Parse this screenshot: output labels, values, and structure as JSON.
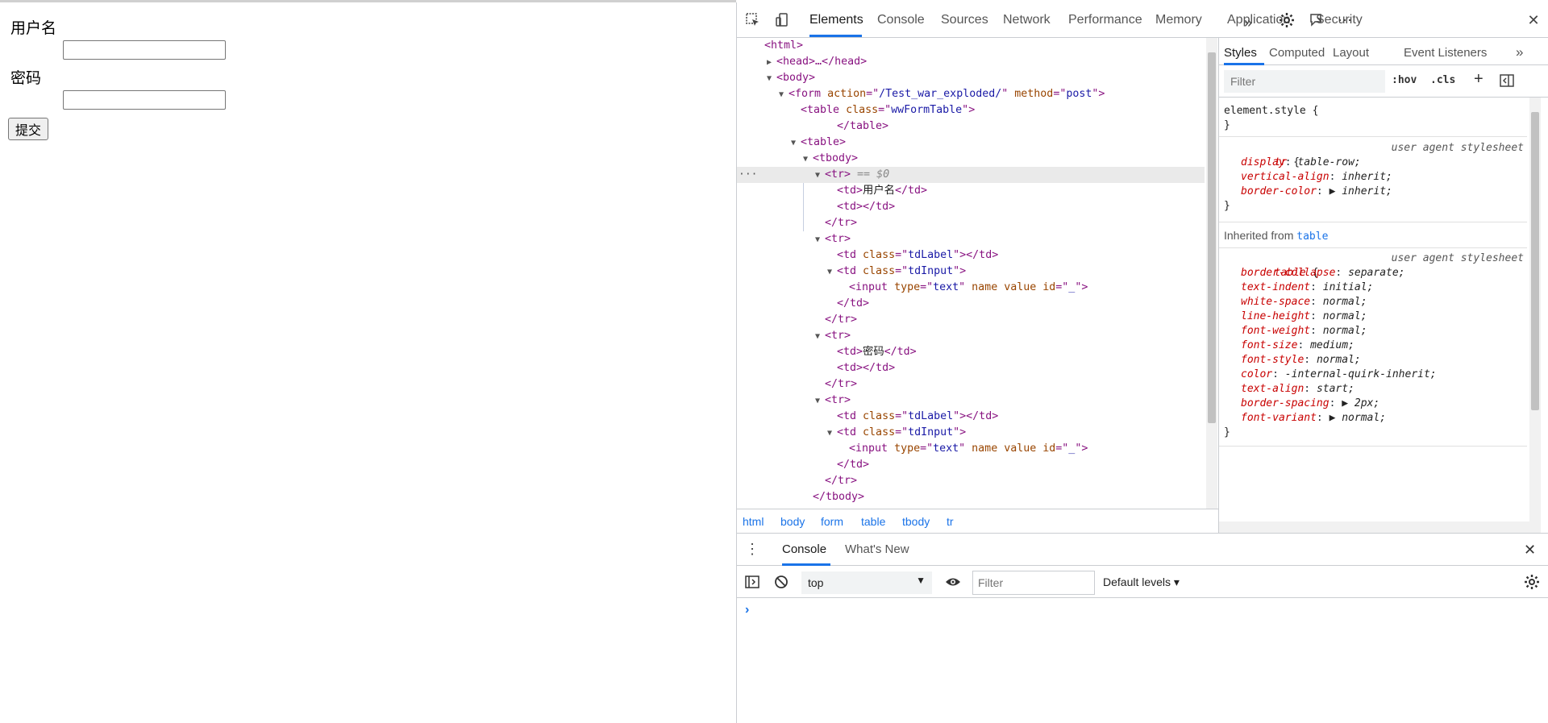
{
  "page": {
    "username_label": "用户名",
    "password_label": "密码",
    "submit_label": "提交",
    "username_value": "",
    "password_value": ""
  },
  "devtools": {
    "tabs": [
      "Elements",
      "Console",
      "Sources",
      "Network",
      "Performance",
      "Memory",
      "Application",
      "Security"
    ],
    "active_tab": "Elements",
    "more_tabs": "»",
    "dom": [
      {
        "indent": 0,
        "tri": "",
        "open": "<",
        "tag": "html",
        "attrs": [],
        "close": ">",
        "text": ""
      },
      {
        "indent": 1,
        "tri": "▶",
        "open": "<",
        "tag": "head",
        "attrs": [],
        "close": ">…</head>",
        "text": ""
      },
      {
        "indent": 1,
        "tri": "▼",
        "open": "<",
        "tag": "body",
        "attrs": [],
        "close": ">",
        "text": ""
      },
      {
        "indent": 2,
        "tri": "▼",
        "open": "<",
        "tag": "form",
        "attrs": [
          [
            "action",
            "/Test_war_exploded/"
          ],
          [
            "method",
            "post"
          ]
        ],
        "close": ">",
        "text": ""
      },
      {
        "indent": 3,
        "tri": "",
        "open": "<",
        "tag": "table",
        "attrs": [
          [
            "class",
            "wwFormTable"
          ]
        ],
        "close": ">",
        "text": ""
      },
      {
        "indent": 6,
        "tri": "",
        "open": "</",
        "tag": "table",
        "attrs": [],
        "close": ">",
        "text": ""
      },
      {
        "indent": 3,
        "tri": "▼",
        "open": "<",
        "tag": "table",
        "attrs": [],
        "close": ">",
        "text": ""
      },
      {
        "indent": 4,
        "tri": "▼",
        "open": "<",
        "tag": "tbody",
        "attrs": [],
        "close": ">",
        "text": ""
      },
      {
        "indent": 5,
        "tri": "▼",
        "open": "<",
        "tag": "tr",
        "attrs": [],
        "close": ">",
        "text": "",
        "suffix": " == $0"
      },
      {
        "indent": 6,
        "tri": "",
        "open": "<",
        "tag": "td",
        "attrs": [],
        "close": ">",
        "text": "用户名",
        "end": "</td>"
      },
      {
        "indent": 6,
        "tri": "",
        "open": "<",
        "tag": "td",
        "attrs": [],
        "close": ">",
        "text": "",
        "end": "</td>"
      },
      {
        "indent": 5,
        "tri": "",
        "open": "</",
        "tag": "tr",
        "attrs": [],
        "close": ">",
        "text": ""
      },
      {
        "indent": 5,
        "tri": "▼",
        "open": "<",
        "tag": "tr",
        "attrs": [],
        "close": ">",
        "text": ""
      },
      {
        "indent": 6,
        "tri": "",
        "open": "<",
        "tag": "td",
        "attrs": [
          [
            "class",
            "tdLabel"
          ]
        ],
        "close": ">",
        "text": "",
        "end": "</td>"
      },
      {
        "indent": 6,
        "tri": "▼",
        "open": "<",
        "tag": "td",
        "attrs": [
          [
            "class",
            "tdInput"
          ]
        ],
        "close": ">",
        "text": ""
      },
      {
        "indent": 7,
        "tri": "",
        "open": "<",
        "tag": "input",
        "attrs": [
          [
            "type",
            "text"
          ],
          [
            "name",
            null
          ],
          [
            "value",
            null
          ],
          [
            "id",
            "_"
          ]
        ],
        "close": ">",
        "text": ""
      },
      {
        "indent": 6,
        "tri": "",
        "open": "</",
        "tag": "td",
        "attrs": [],
        "close": ">",
        "text": ""
      },
      {
        "indent": 5,
        "tri": "",
        "open": "</",
        "tag": "tr",
        "attrs": [],
        "close": ">",
        "text": ""
      },
      {
        "indent": 5,
        "tri": "▼",
        "open": "<",
        "tag": "tr",
        "attrs": [],
        "close": ">",
        "text": ""
      },
      {
        "indent": 6,
        "tri": "",
        "open": "<",
        "tag": "td",
        "attrs": [],
        "close": ">",
        "text": "密码",
        "end": "</td>"
      },
      {
        "indent": 6,
        "tri": "",
        "open": "<",
        "tag": "td",
        "attrs": [],
        "close": ">",
        "text": "",
        "end": "</td>"
      },
      {
        "indent": 5,
        "tri": "",
        "open": "</",
        "tag": "tr",
        "attrs": [],
        "close": ">",
        "text": ""
      },
      {
        "indent": 5,
        "tri": "▼",
        "open": "<",
        "tag": "tr",
        "attrs": [],
        "close": ">",
        "text": ""
      },
      {
        "indent": 6,
        "tri": "",
        "open": "<",
        "tag": "td",
        "attrs": [
          [
            "class",
            "tdLabel"
          ]
        ],
        "close": ">",
        "text": "",
        "end": "</td>"
      },
      {
        "indent": 6,
        "tri": "▼",
        "open": "<",
        "tag": "td",
        "attrs": [
          [
            "class",
            "tdInput"
          ]
        ],
        "close": ">",
        "text": ""
      },
      {
        "indent": 7,
        "tri": "",
        "open": "<",
        "tag": "input",
        "attrs": [
          [
            "type",
            "text"
          ],
          [
            "name",
            null
          ],
          [
            "value",
            null
          ],
          [
            "id",
            "_"
          ]
        ],
        "close": ">",
        "text": ""
      },
      {
        "indent": 6,
        "tri": "",
        "open": "</",
        "tag": "td",
        "attrs": [],
        "close": ">",
        "text": ""
      },
      {
        "indent": 5,
        "tri": "",
        "open": "</",
        "tag": "tr",
        "attrs": [],
        "close": ">",
        "text": ""
      },
      {
        "indent": 4,
        "tri": "",
        "open": "</",
        "tag": "tbody",
        "attrs": [],
        "close": ">",
        "text": ""
      }
    ],
    "breadcrumbs": [
      "html",
      "body",
      "form",
      "table",
      "tbody",
      "tr"
    ],
    "styles_tabs": [
      "Styles",
      "Computed",
      "Layout",
      "Event Listeners"
    ],
    "styles_more": "»",
    "filter_placeholder": "Filter",
    "hov": ":hov",
    "cls": ".cls",
    "element_style_open": "element.style {",
    "element_style_close": "}",
    "rule_tr": {
      "selector": "tr",
      "source": "user agent stylesheet",
      "props": [
        [
          "display",
          "table-row;"
        ],
        [
          "vertical-align",
          "inherit;"
        ],
        [
          "border-color",
          "▶ inherit;"
        ]
      ]
    },
    "inherited_from_label": "Inherited from",
    "inherited_from_link": "table",
    "rule_table": {
      "selector": "table",
      "source": "user agent stylesheet",
      "props": [
        [
          "border-collapse",
          "separate;"
        ],
        [
          "text-indent",
          "initial;"
        ],
        [
          "white-space",
          "normal;"
        ],
        [
          "line-height",
          "normal;"
        ],
        [
          "font-weight",
          "normal;"
        ],
        [
          "font-size",
          "medium;"
        ],
        [
          "font-style",
          "normal;"
        ],
        [
          "color",
          "-internal-quirk-inherit;"
        ],
        [
          "text-align",
          "start;"
        ],
        [
          "border-spacing",
          "▶ 2px;"
        ],
        [
          "font-variant",
          "▶ normal;"
        ]
      ]
    },
    "drawer": {
      "tabs": [
        "Console",
        "What's New"
      ],
      "active_tab": "Console",
      "context": "top",
      "filter_placeholder": "Filter",
      "levels": "Default levels ▾",
      "prompt": "›"
    },
    "colors": {
      "accent": "#1a73e8",
      "tag": "#881280",
      "attr": "#994500",
      "val": "#1a1aa6"
    }
  }
}
